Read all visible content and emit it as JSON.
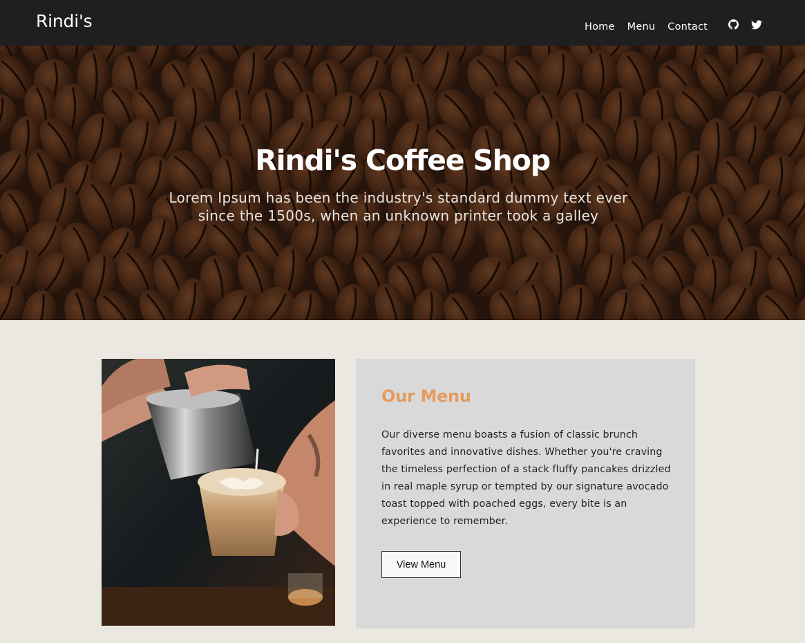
{
  "navbar": {
    "brand": "Rindi's",
    "links": [
      {
        "label": "Home"
      },
      {
        "label": "Menu"
      },
      {
        "label": "Contact"
      }
    ],
    "social": [
      {
        "icon": "github-icon"
      },
      {
        "icon": "twitter-icon"
      }
    ]
  },
  "hero": {
    "title": "Rindi's Coffee Shop",
    "subtitle": "Lorem Ipsum has been the industry's standard dummy text ever since the 1500s, when an unknown printer took a galley"
  },
  "menu_section": {
    "image": "latte-art-photo",
    "title": "Our Menu",
    "description": "Our diverse menu boasts a fusion of classic brunch favorites and innovative dishes. Whether you're craving the timeless perfection of a stack fluffy pancakes drizzled in real maple syrup or tempted by our signature avocado toast topped with poached eggs, every bite is an experience to remember.",
    "button_label": "View Menu"
  },
  "colors": {
    "navbar_bg": "#1f1f1f",
    "page_bg": "#ebe8e1",
    "card_bg": "#d9d9d9",
    "accent": "#e39c5d"
  }
}
